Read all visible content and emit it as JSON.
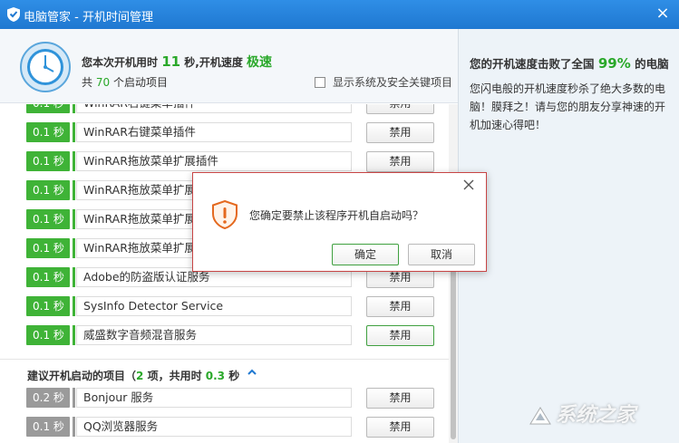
{
  "window": {
    "title": "电脑管家 - 开机时间管理",
    "close_glyph": "×"
  },
  "header": {
    "line1_prefix": "您本次开机用时",
    "boot_seconds": "11",
    "line1_mid": "秒,开机速度",
    "speed_label": "极速",
    "line2_prefix": "共",
    "startup_count": "70",
    "line2_suffix": "个启动项目",
    "show_system_label": "显示系统及安全关键项目"
  },
  "disable_label": "禁用",
  "rows": [
    {
      "time": "0.1 秒",
      "name": "WinRAR右键菜单插件"
    },
    {
      "time": "0.1 秒",
      "name": "WinRAR右键菜单插件"
    },
    {
      "time": "0.1 秒",
      "name": "WinRAR拖放菜单扩展插件"
    },
    {
      "time": "0.1 秒",
      "name": "WinRAR拖放菜单扩展插件"
    },
    {
      "time": "0.1 秒",
      "name": "WinRAR拖放菜单扩展插件"
    },
    {
      "time": "0.1 秒",
      "name": "WinRAR拖放菜单扩展插件"
    },
    {
      "time": "0.1 秒",
      "name": "Adobe的防盗版认证服务"
    },
    {
      "time": "0.1 秒",
      "name": "SysInfo Detector Service"
    },
    {
      "time": "0.1 秒",
      "name": "威盛数字音频混音服务"
    }
  ],
  "suggested_section": {
    "prefix": "建议开机启动的项目（",
    "count": "2",
    "mid": "项，共用时",
    "time": "0.3",
    "suffix": "秒"
  },
  "suggested_rows": [
    {
      "time": "0.2 秒",
      "name": "Bonjour 服务"
    },
    {
      "time": "0.1 秒",
      "name": "QQ浏览器服务"
    }
  ],
  "right_panel": {
    "title_prefix": "您的开机速度击败了全国",
    "percent": "99%",
    "title_suffix": "的电脑",
    "body": "您闪电般的开机速度秒杀了绝大多数的电脑！膜拜之！请与您的朋友分享神速的开机加速心得吧！"
  },
  "dialog": {
    "message": "您确定要禁止该程序开机自启动吗？",
    "ok_label": "确定",
    "cancel_label": "取消"
  },
  "watermark": "系统之家",
  "colors": {
    "title_bar": "#1f78d1",
    "green_badge": "#3fb337",
    "gray_badge": "#9a9a9a",
    "dialog_border": "#c84545",
    "highlight_green": "#2aa82a"
  }
}
